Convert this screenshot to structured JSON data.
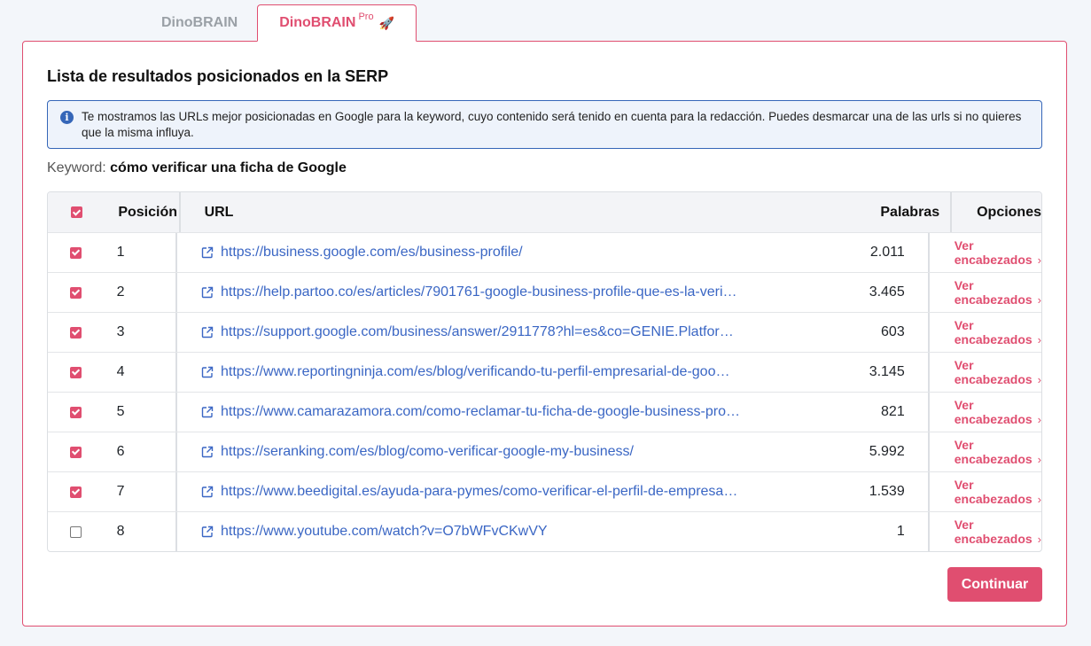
{
  "tabs": [
    {
      "label": "DinoBRAIN",
      "active": false
    },
    {
      "label": "DinoBRAIN",
      "sup": "Pro",
      "icon": "rocket-icon",
      "active": true
    }
  ],
  "title": "Lista de resultados posicionados en la SERP",
  "info_text": "Te mostramos las URLs mejor posicionadas en Google para la keyword, cuyo contenido será tenido en cuenta para la redacción. Puedes desmarcar una de las urls si no quieres que la misma influya.",
  "keyword": {
    "label": "Keyword:",
    "value": "cómo verificar una ficha de Google"
  },
  "table": {
    "headers": {
      "position": "Posición",
      "url": "URL",
      "words": "Palabras",
      "options": "Opciones"
    },
    "select_all_checked": true,
    "rows": [
      {
        "checked": true,
        "position": "1",
        "url": "https://business.google.com/es/business-profile/",
        "words": "2.011",
        "option": "Ver encabezados"
      },
      {
        "checked": true,
        "position": "2",
        "url": "https://help.partoo.co/es/articles/7901761-google-business-profile-que-es-la-veri…",
        "words": "3.465",
        "option": "Ver encabezados"
      },
      {
        "checked": true,
        "position": "3",
        "url": "https://support.google.com/business/answer/2911778?hl=es&co=GENIE.Platfor…",
        "words": "603",
        "option": "Ver encabezados"
      },
      {
        "checked": true,
        "position": "4",
        "url": "https://www.reportingninja.com/es/blog/verificando-tu-perfil-empresarial-de-goo…",
        "words": "3.145",
        "option": "Ver encabezados"
      },
      {
        "checked": true,
        "position": "5",
        "url": "https://www.camarazamora.com/como-reclamar-tu-ficha-de-google-business-pro…",
        "words": "821",
        "option": "Ver encabezados"
      },
      {
        "checked": true,
        "position": "6",
        "url": "https://seranking.com/es/blog/como-verificar-google-my-business/",
        "words": "5.992",
        "option": "Ver encabezados"
      },
      {
        "checked": true,
        "position": "7",
        "url": "https://www.beedigital.es/ayuda-para-pymes/como-verificar-el-perfil-de-empresa-…",
        "words": "1.539",
        "option": "Ver encabezados"
      },
      {
        "checked": false,
        "position": "8",
        "url": "https://www.youtube.com/watch?v=O7bWFvCKwVY",
        "words": "1",
        "option": "Ver encabezados"
      }
    ]
  },
  "continue_label": "Continuar",
  "colors": {
    "accent": "#e04e70",
    "link": "#3a66c4",
    "info_border": "#3566b8"
  }
}
